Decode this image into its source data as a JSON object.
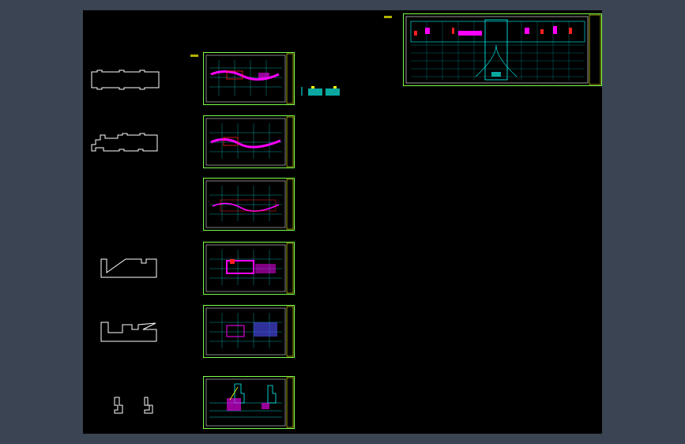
{
  "app": {
    "viewport_label": ""
  },
  "colors": {
    "background": "#3b4453",
    "canvas": "#000000",
    "frame_green": "#7cff4a",
    "frame_yellow": "#ffff00",
    "grid_cyan": "#00ffff",
    "magenta": "#ff00ff",
    "red": "#ff2020",
    "white": "#ffffff",
    "teal_block": "#0aa8a0"
  },
  "sheets": [
    {
      "id": "sheet-1",
      "icon": "floor-plan-drawing"
    },
    {
      "id": "sheet-2",
      "icon": "floor-plan-drawing"
    },
    {
      "id": "sheet-3",
      "icon": "floor-plan-drawing"
    },
    {
      "id": "sheet-4",
      "icon": "floor-plan-drawing"
    },
    {
      "id": "sheet-5",
      "icon": "floor-plan-drawing"
    },
    {
      "id": "sheet-6",
      "icon": "section-drawing"
    }
  ],
  "large_sheet": {
    "icon": "site-plan-drawing"
  },
  "outlines": [
    {
      "id": "outline-1",
      "icon": "building-outline"
    },
    {
      "id": "outline-2",
      "icon": "building-outline"
    },
    {
      "id": "outline-3",
      "icon": "building-outline"
    },
    {
      "id": "outline-4",
      "icon": "building-outline"
    },
    {
      "id": "outline-5",
      "icon": "detail-outline"
    }
  ]
}
